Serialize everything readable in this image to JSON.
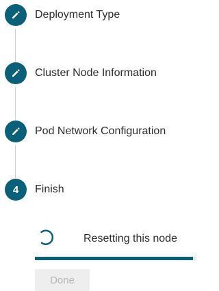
{
  "colors": {
    "accent": "#0a5f79",
    "connector": "#cfcfcf",
    "track": "#e6e6e6",
    "disabled_bg": "#eeeeee",
    "disabled_text": "#b5b5b5"
  },
  "steps": [
    {
      "label": "Deployment Type",
      "state": "completed",
      "icon": "pencil-icon"
    },
    {
      "label": "Cluster Node Information",
      "state": "completed",
      "icon": "pencil-icon"
    },
    {
      "label": "Pod Network Configuration",
      "state": "completed",
      "icon": "pencil-icon"
    },
    {
      "label": "Finish",
      "state": "current",
      "number": "4"
    }
  ],
  "progress": {
    "status_text": "Resetting this node",
    "percent": 98,
    "icon": "spinner-icon"
  },
  "done_button": {
    "label": "Done",
    "disabled": true
  }
}
